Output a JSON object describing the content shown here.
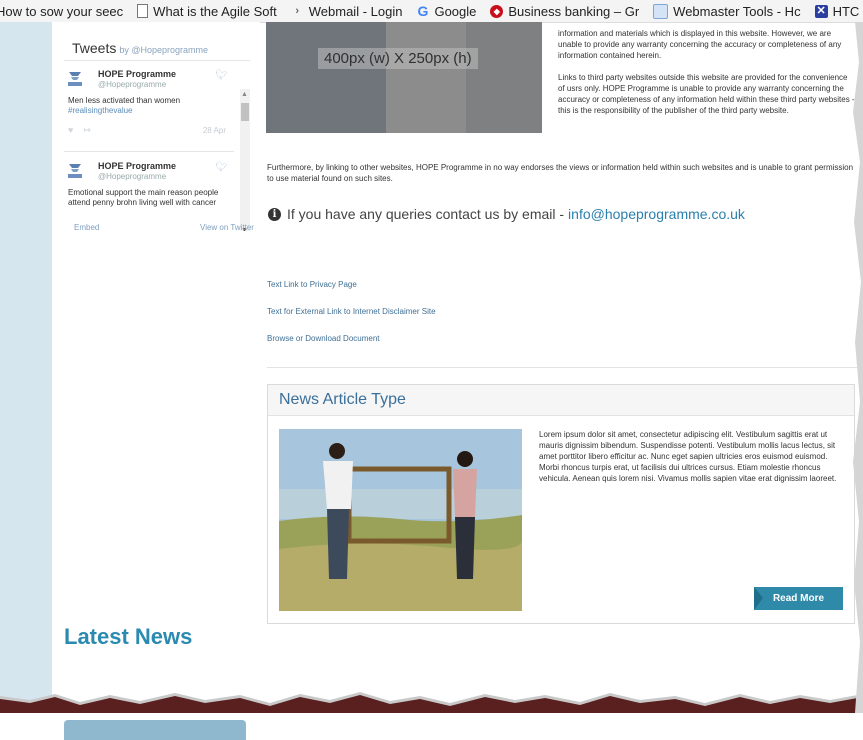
{
  "bookmarks": [
    {
      "label": "How to sow your seec",
      "icon": "none"
    },
    {
      "label": "What is the Agile Soft",
      "icon": "document-icon"
    },
    {
      "label": "Webmail - Login",
      "icon": "mail-icon"
    },
    {
      "label": "Google",
      "icon": "google-icon"
    },
    {
      "label": "Business banking – Gr",
      "icon": "bank-icon"
    },
    {
      "label": "Webmaster Tools - Hc",
      "icon": "webmaster-icon"
    },
    {
      "label": "HTC",
      "icon": "htc-icon"
    }
  ],
  "tweets": {
    "title": "Tweets",
    "by": "by @Hopeprogramme",
    "items": [
      {
        "name": "HOPE Programme",
        "handle": "@Hopeprogramme",
        "text": "Men less activated than women",
        "tag": "#realisingthevalue",
        "date": "28 Apr"
      },
      {
        "name": "HOPE Programme",
        "handle": "@Hopeprogramme",
        "text": "Emotional support the main reason people attend penny brohn living well with cancer",
        "tag": "",
        "date": ""
      }
    ],
    "embed": "Embed",
    "view_on_twitter": "View on Twitter"
  },
  "latest_news": "Latest News",
  "placeholder_label": "400px (w) X 250px (h)",
  "disclaimer": {
    "p1": "information and materials which is displayed in this website. However, we are unable to provide any warranty concerning the accuracy or completeness of any information contained herein.",
    "p2": "Links to third party websites outside this website are provided for the convenience of usrs only. HOPE Programme is unable to provide any warranty concerning the accuracy or completeness of any information held within these third party websites - this is the responsibility of the publisher of the third party website."
  },
  "further": "Furthermore, by linking to other websites, HOPE Programme in no way endorses the views or information held within such websites and is unable to grant permission to use material found on such sites.",
  "contact": {
    "text": "If you have any queries contact us by email -",
    "email": "info@hopeprogramme.co.uk"
  },
  "links": [
    "Text Link to Privacy Page",
    "Text for External Link to Internet Disclaimer Site",
    "Browse or Download Document"
  ],
  "article": {
    "title": "News Article Type",
    "body": "Lorem ipsum dolor sit amet, consectetur adipiscing elit. Vestibulum sagittis erat ut mauris dignissim bibendum. Suspendisse potenti. Vestibulum mollis lacus lectus, sit amet porttitor libero efficitur ac. Nunc eget sapien ultricies eros euismod euismod. Morbi rhoncus turpis erat, ut facilisis dui ultrices cursus. Etiam molestie rhoncus vehicula. Aenean quis lorem nisi. Vivamus mollis sapien vitae erat dignissim laoreet.",
    "read_more": "Read More"
  },
  "colors": {
    "rail": "#d6e6ef",
    "accent": "#2a8ab0",
    "read_more": "#2e8aa8",
    "link": "#3e6f95"
  }
}
